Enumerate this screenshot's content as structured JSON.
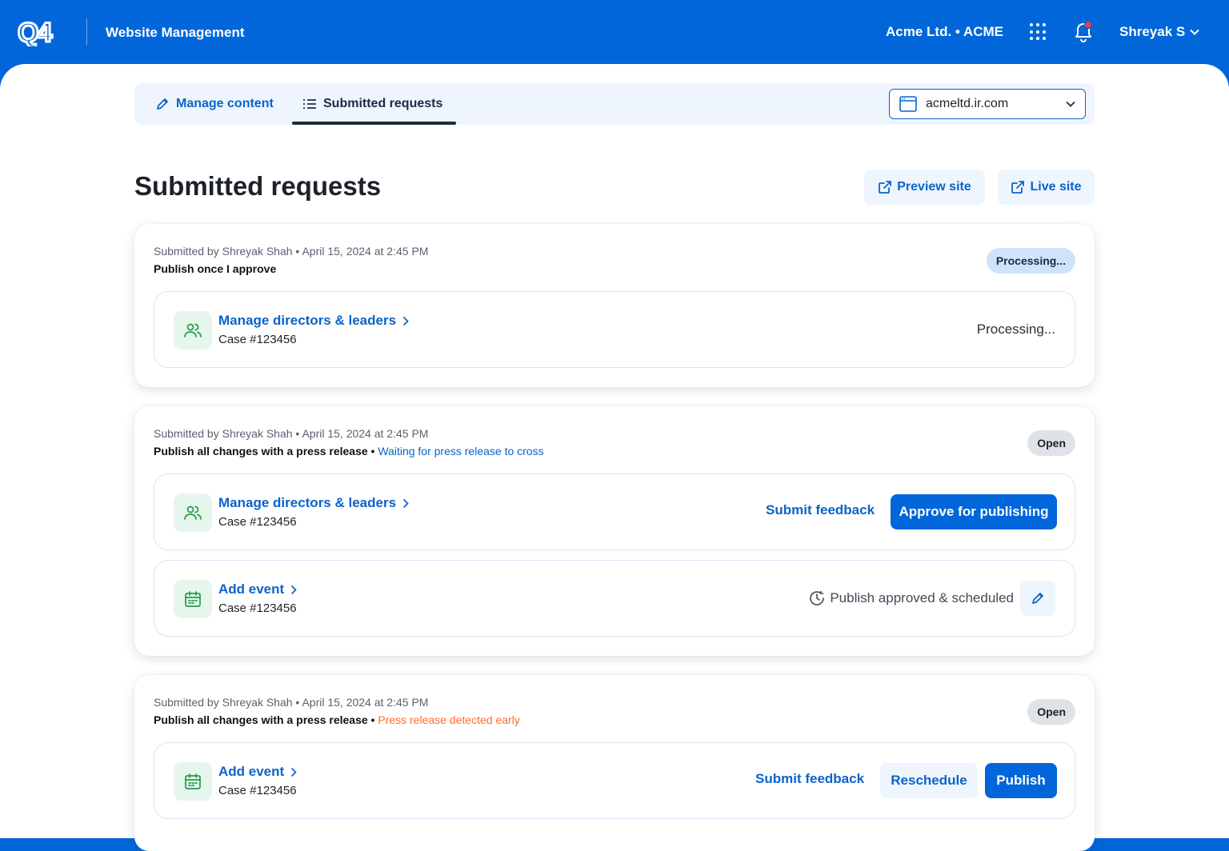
{
  "header": {
    "logo_text": "Q4",
    "app_title": "Website Management",
    "org": "Acme Ltd. • ACME",
    "user": "Shreyak S"
  },
  "tabs": {
    "manage": "Manage content",
    "submitted": "Submitted requests",
    "active": "submitted"
  },
  "site_select": {
    "value": "acmeltd.ir.com"
  },
  "page": {
    "title": "Submitted requests",
    "preview_btn": "Preview site",
    "live_btn": "Live site"
  },
  "requests": [
    {
      "meta": "Submitted by Shreyak Shah • April 15, 2024 at 2:45 PM",
      "policy": "Publish once I approve",
      "badge": "Processing...",
      "items": [
        {
          "icon": "users-icon",
          "title": "Manage directors & leaders",
          "case": "Case #123456",
          "status": "Processing..."
        }
      ]
    },
    {
      "meta": "Submitted by Shreyak Shah • April 15, 2024 at 2:45 PM",
      "policy": "Publish all changes with a press release",
      "note": "Waiting for press release to cross",
      "badge": "Open",
      "items": [
        {
          "icon": "users-icon",
          "title": "Manage directors & leaders",
          "case": "Case #123456",
          "feedback": "Submit feedback",
          "approve": "Approve for publishing"
        },
        {
          "icon": "calendar-icon",
          "title": "Add event",
          "case": "Case #123456",
          "status": "Publish approved & scheduled"
        }
      ]
    },
    {
      "meta": "Submitted by Shreyak Shah • April 15, 2024 at 2:45 PM",
      "policy": "Publish all changes with a press release",
      "note": "Press release detected early",
      "badge": "Open",
      "items": [
        {
          "icon": "calendar-icon",
          "title": "Add event",
          "case": "Case #123456",
          "feedback": "Submit feedback",
          "reschedule": "Reschedule",
          "publish": "Publish"
        }
      ]
    }
  ],
  "colors": {
    "brand": "#0066d9",
    "link": "#0b63c9",
    "warning": "#ff6b2c",
    "icon_green": "#1f9d4c"
  }
}
